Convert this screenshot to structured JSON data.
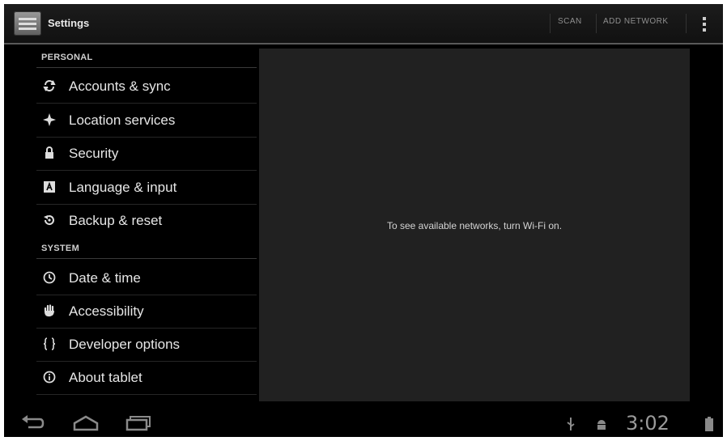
{
  "action_bar": {
    "title": "Settings",
    "scan_label": "SCAN",
    "add_network_label": "ADD NETWORK"
  },
  "settings": {
    "personal_header": "PERSONAL",
    "system_header": "SYSTEM",
    "personal_items": [
      {
        "label": "Accounts & sync",
        "icon": "sync-icon"
      },
      {
        "label": "Location services",
        "icon": "location-icon"
      },
      {
        "label": "Security",
        "icon": "lock-icon"
      },
      {
        "label": "Language & input",
        "icon": "keyboard-icon"
      },
      {
        "label": "Backup & reset",
        "icon": "backup-icon"
      }
    ],
    "system_items": [
      {
        "label": "Date & time",
        "icon": "clock-icon"
      },
      {
        "label": "Accessibility",
        "icon": "hand-icon"
      },
      {
        "label": "Developer options",
        "icon": "braces-icon"
      },
      {
        "label": "About tablet",
        "icon": "info-icon"
      }
    ]
  },
  "wifi_panel": {
    "message": "To see available networks, turn Wi-Fi on."
  },
  "status_bar": {
    "time": "3:02"
  },
  "colors": {
    "background": "#000000",
    "panel": "#212121",
    "text": "#e6e6e6"
  }
}
